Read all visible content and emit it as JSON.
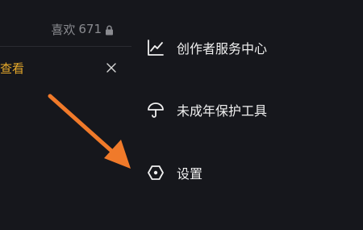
{
  "header": {
    "likes_label": "喜欢",
    "likes_count": "671"
  },
  "banner": {
    "view_label": "查看"
  },
  "menu": {
    "items": [
      {
        "label": "创作者服务中心",
        "icon": "chart-line-icon"
      },
      {
        "label": "未成年保护工具",
        "icon": "umbrella-icon"
      },
      {
        "label": "设置",
        "icon": "hexagon-settings-icon"
      }
    ]
  },
  "colors": {
    "background": "#16171c",
    "accent": "#e6a92a",
    "annotation_arrow": "#f07a2a",
    "muted_text": "#8a8b90"
  }
}
